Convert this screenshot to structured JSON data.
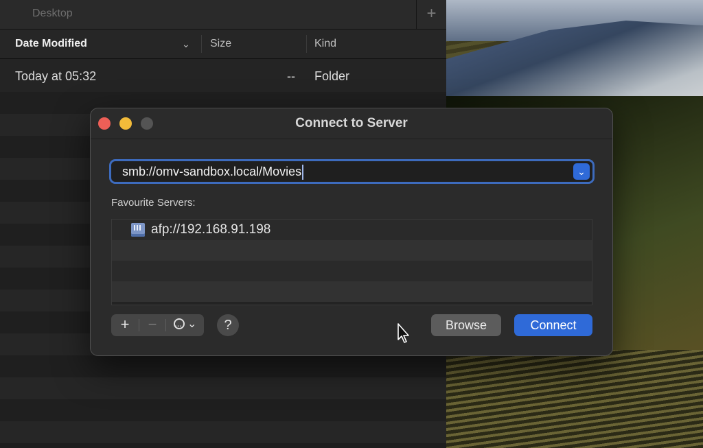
{
  "finder": {
    "tab_title": "Desktop",
    "tab_add": "+",
    "columns": {
      "date_modified": "Date Modified",
      "size": "Size",
      "kind": "Kind"
    },
    "rows": [
      {
        "date": "Today at 05:32",
        "size": "--",
        "kind": "Folder"
      }
    ]
  },
  "dialog": {
    "title": "Connect to Server",
    "address_value": "smb://omv-sandbox.local/Movies",
    "favourites_label": "Favourite Servers:",
    "favourites": [
      {
        "address": "afp://192.168.91.198",
        "icon": "server-icon"
      }
    ],
    "buttons": {
      "add": "+",
      "remove": "−",
      "help": "?",
      "browse": "Browse",
      "connect": "Connect"
    }
  },
  "colors": {
    "accent": "#2f6ad8",
    "close": "#ee5f57",
    "minimize": "#f2bb3a"
  }
}
